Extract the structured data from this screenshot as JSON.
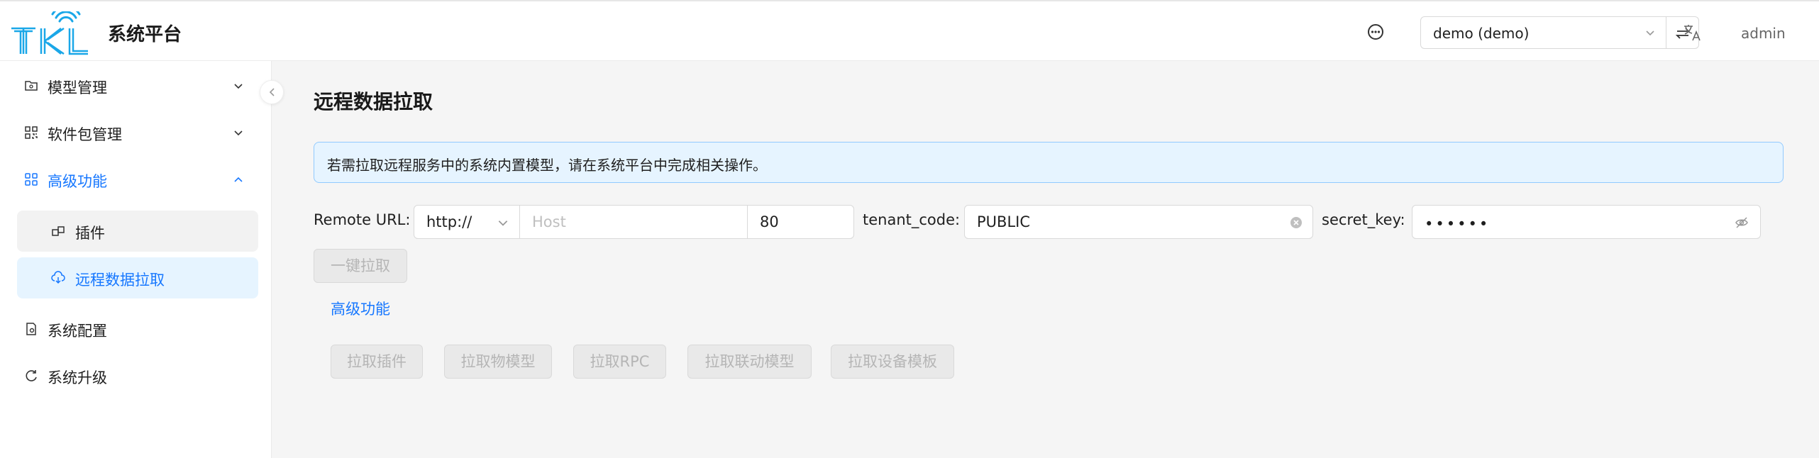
{
  "header": {
    "app_title": "系统平台",
    "logo_text": "TKL",
    "project_value": "demo (demo)",
    "user": "admin"
  },
  "sidebar": {
    "items": [
      {
        "label": "模型管理",
        "icon": "folder-icon",
        "expandable": true
      },
      {
        "label": "软件包管理",
        "icon": "grid-icon",
        "expandable": true
      },
      {
        "label": "高级功能",
        "icon": "apps-icon",
        "expandable": true,
        "expanded": true,
        "active": true
      },
      {
        "label": "系统配置",
        "icon": "file-settings-icon"
      },
      {
        "label": "系统升级",
        "icon": "refresh-icon"
      }
    ],
    "sub_items": [
      {
        "label": "插件",
        "icon": "plugin-icon"
      },
      {
        "label": "远程数据拉取",
        "icon": "cloud-download-icon",
        "selected": true
      }
    ]
  },
  "main": {
    "title": "远程数据拉取",
    "alert": "若需拉取远程服务中的系统内置模型，请在系统平台中完成相关操作。",
    "form": {
      "remote_url_label": "Remote URL",
      "protocol_value": "http://",
      "host_placeholder": "Host",
      "port_value": "80",
      "tenant_label": "tenant_code",
      "tenant_value": "PUBLIC",
      "secret_label": "secret_key",
      "secret_value": "••••••"
    },
    "pull_all_button": "一键拉取",
    "advanced_link": "高级功能",
    "pull_buttons": [
      "拉取插件",
      "拉取物模型",
      "拉取RPC",
      "拉取联动模型",
      "拉取设备模板"
    ]
  },
  "colors": {
    "accent": "#1677ff",
    "alert_bg": "#e6f4ff",
    "alert_border": "#91caff",
    "selected_bg": "#e6f4ff"
  }
}
